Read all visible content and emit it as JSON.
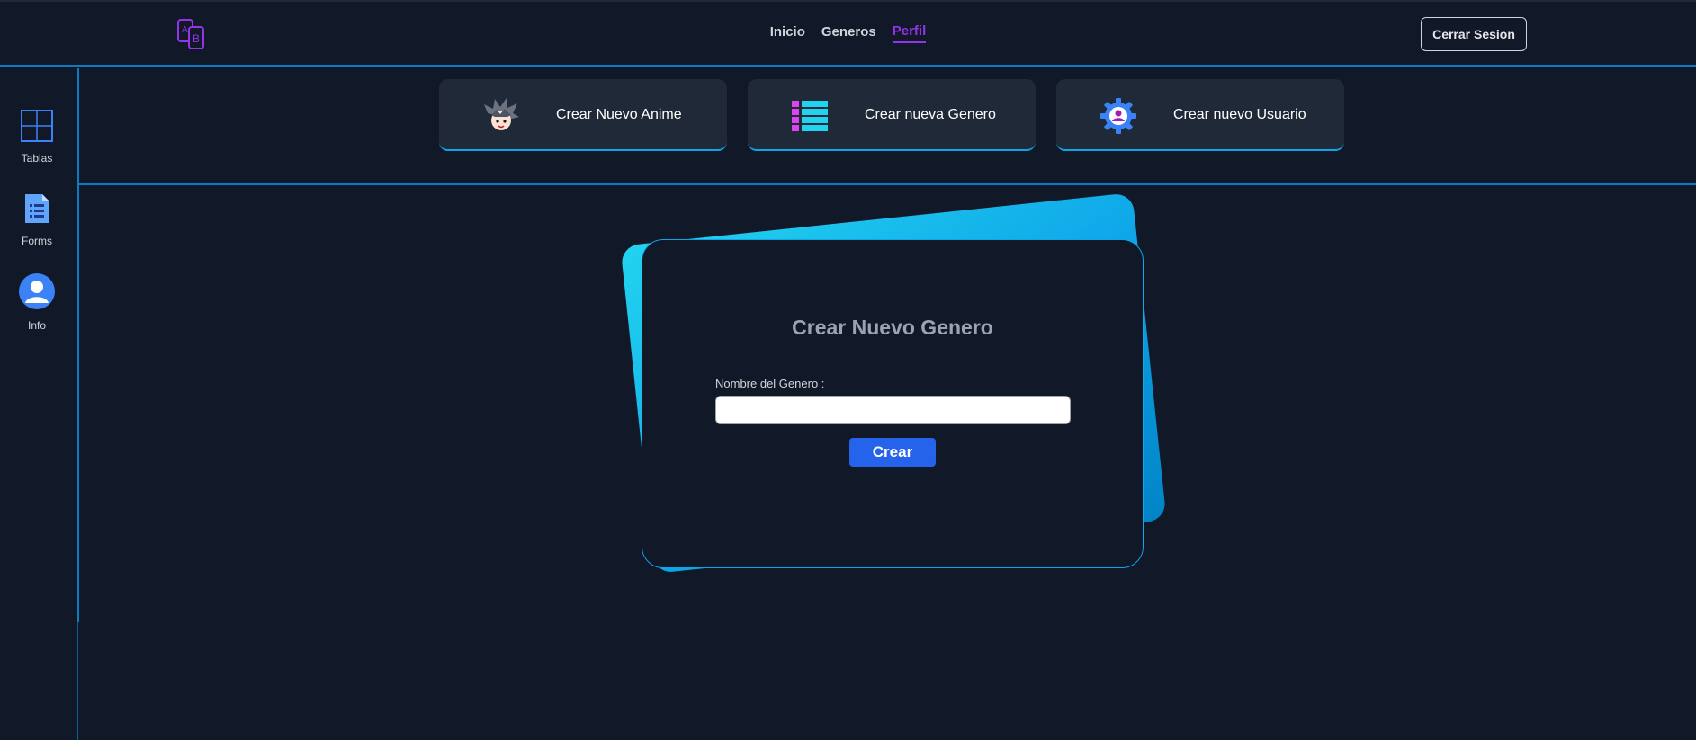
{
  "nav": {
    "links": [
      "Inicio",
      "Generos",
      "Perfil"
    ],
    "active": "Perfil",
    "logout_label": "Cerrar Sesion",
    "logo_icon": "translate-ab-icon"
  },
  "sidebar": {
    "items": [
      {
        "label": "Tablas",
        "icon": "table-grid-icon"
      },
      {
        "label": "Forms",
        "icon": "document-form-icon"
      },
      {
        "label": "Info",
        "icon": "user-avatar-icon"
      }
    ]
  },
  "shortcuts": [
    {
      "label": "Crear Nuevo Anime",
      "icon": "anime-face-icon"
    },
    {
      "label": "Crear nueva Genero",
      "icon": "list-icon"
    },
    {
      "label": "Crear nuevo Usuario",
      "icon": "user-settings-gear-icon"
    }
  ],
  "form": {
    "title": "Crear Nuevo Genero",
    "field_label": "Nombre del Genero :",
    "field_value": "",
    "submit_label": "Crear"
  },
  "colors": {
    "background": "#111827",
    "card": "#1f2937",
    "accent_line": "#0b7bc2",
    "active_link": "#9333ea",
    "button": "#2563eb",
    "back_card": "#0ea5e9"
  }
}
